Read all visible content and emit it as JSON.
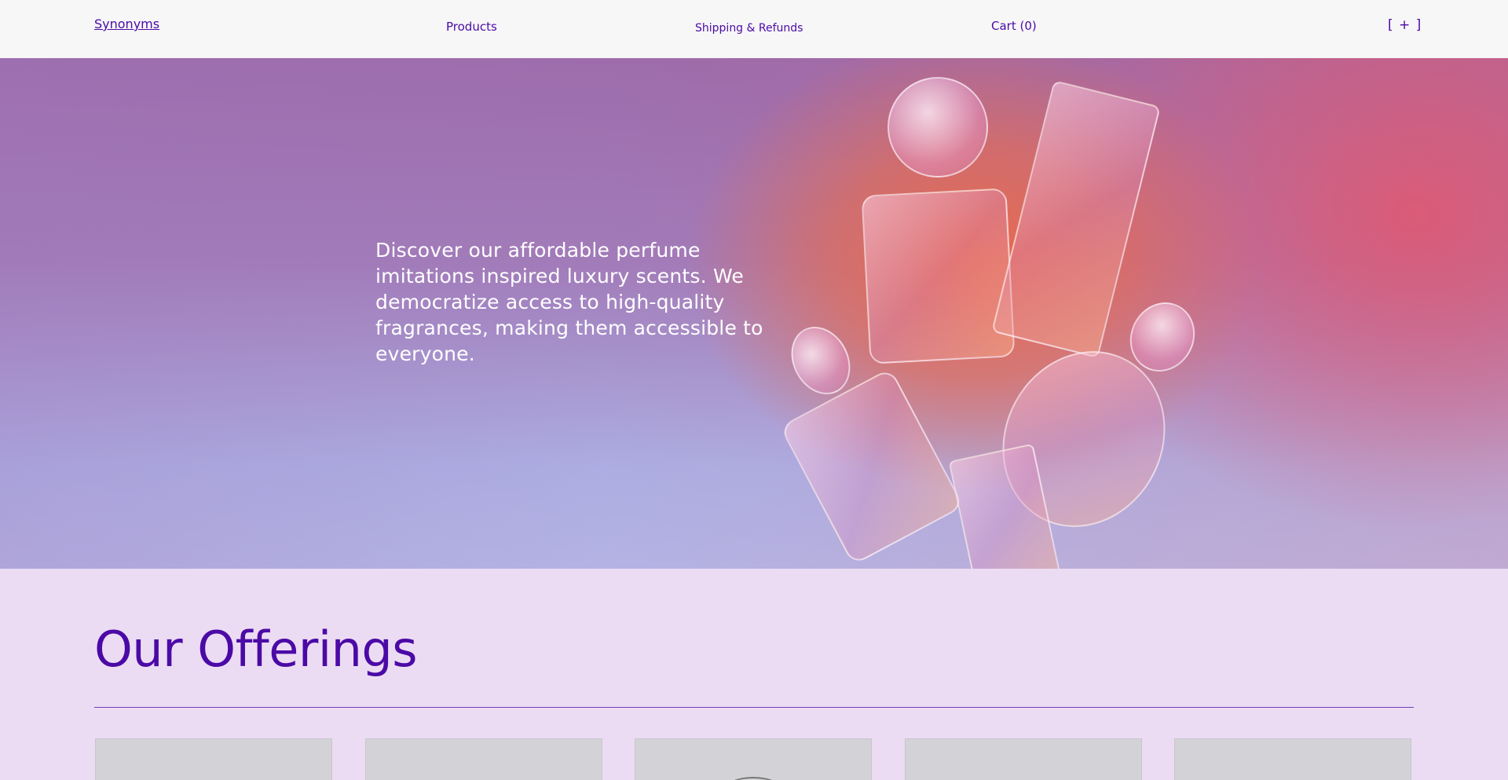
{
  "header": {
    "logo": "Synonyms",
    "nav": {
      "products": "Products",
      "shipping": "Shipping & Refunds",
      "cart": "Cart (0)",
      "menu": "[ + ]"
    }
  },
  "hero": {
    "text": "Discover our affordable perfume imitations inspired luxury scents. We democratize access to high-quality fragrances, making them accessible to everyone."
  },
  "offerings": {
    "title": "Our Offerings",
    "card_count_visible": 5
  },
  "colors": {
    "accent": "#4b0aa6",
    "header_bg": "#f7f7f7",
    "page_bg": "#ecdcf3"
  }
}
